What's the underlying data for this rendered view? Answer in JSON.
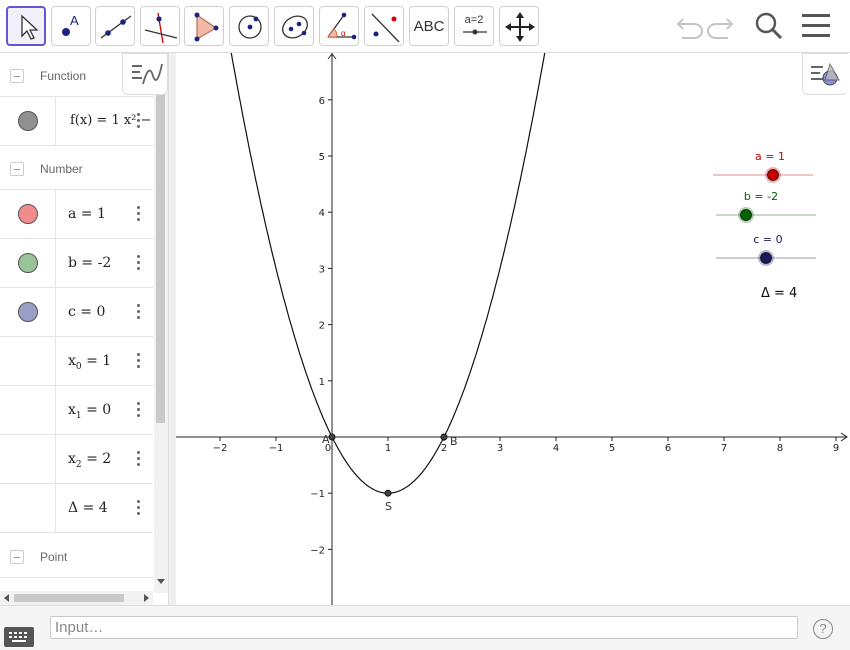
{
  "toolbar": {
    "tools": [
      {
        "name": "move-tool",
        "label": ""
      },
      {
        "name": "point-tool",
        "label": ""
      },
      {
        "name": "line-tool",
        "label": ""
      },
      {
        "name": "perpendicular-line-tool",
        "label": ""
      },
      {
        "name": "polygon-tool",
        "label": ""
      },
      {
        "name": "circle-center-point-tool",
        "label": ""
      },
      {
        "name": "ellipse-tool",
        "label": ""
      },
      {
        "name": "angle-tool",
        "label": ""
      },
      {
        "name": "reflect-tool",
        "label": ""
      },
      {
        "name": "text-tool",
        "label": "ABC"
      },
      {
        "name": "slider-tool",
        "label": "a=2"
      },
      {
        "name": "move-graphics-view-tool",
        "label": ""
      }
    ],
    "icons": [
      "undo-icon",
      "redo-icon",
      "search-icon",
      "menu-icon"
    ]
  },
  "algebra": {
    "groups": {
      "function": "Function",
      "number": "Number",
      "point": "Point"
    },
    "function_row": {
      "text": "f(x) = 1 x² −",
      "color": "#909090"
    },
    "number_rows": [
      {
        "text": "a = 1",
        "color": "#f28b8b"
      },
      {
        "text": "b = -2",
        "color": "#98c498"
      },
      {
        "text": "c = 0",
        "color": "#9a9ec9"
      }
    ],
    "var_rows": [
      {
        "sym": "x",
        "sub": "0",
        "rest": " = 1"
      },
      {
        "sym": "x",
        "sub": "1",
        "rest": " = 0"
      },
      {
        "sym": "x",
        "sub": "2",
        "rest": " = 2"
      },
      {
        "sym": "Δ",
        "sub": "",
        "rest": " = 4"
      }
    ]
  },
  "graphics": {
    "x_ticks": [
      "−2",
      "−1",
      "0",
      "1",
      "2",
      "3",
      "4",
      "5",
      "6",
      "7",
      "8",
      "9"
    ],
    "y_ticks": [
      "6",
      "5",
      "4",
      "3",
      "2",
      "1",
      "−1",
      "−2"
    ],
    "points": {
      "A": "A",
      "B": "B",
      "S": "S"
    },
    "sliders": [
      {
        "label": "a = 1",
        "color": "#cc0000",
        "value": 1,
        "min": -5,
        "max": 5
      },
      {
        "label": "b = -2",
        "color": "#006400",
        "value": -2,
        "min": -5,
        "max": 5
      },
      {
        "label": "c = 0",
        "color": "#1a1a5a",
        "value": 0,
        "min": -5,
        "max": 5
      }
    ],
    "delta_text": "Δ = 4"
  },
  "input": {
    "placeholder": "Input…",
    "help": "?"
  }
}
